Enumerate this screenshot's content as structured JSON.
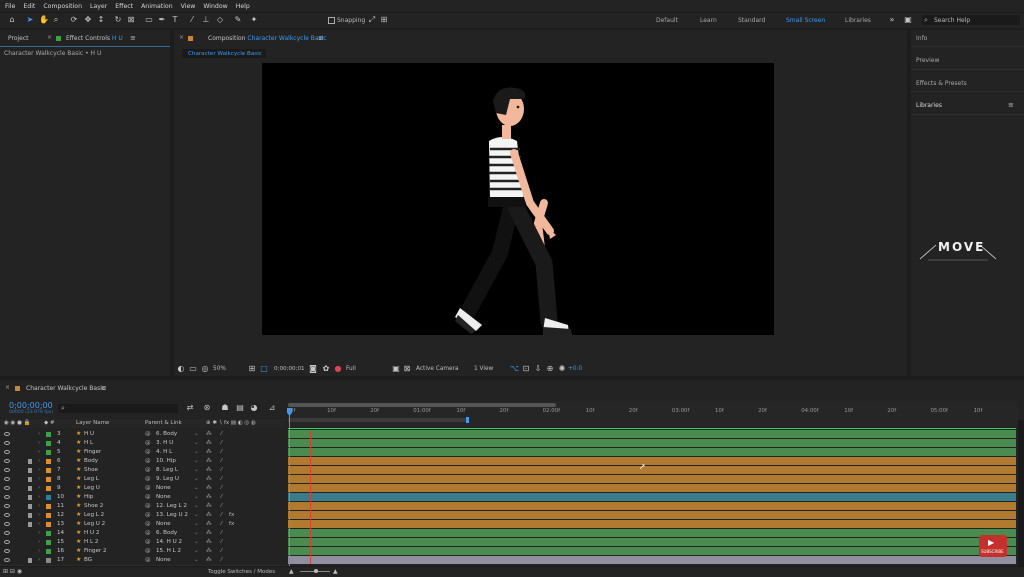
{
  "menu": [
    "File",
    "Edit",
    "Composition",
    "Layer",
    "Effect",
    "Animation",
    "View",
    "Window",
    "Help"
  ],
  "toolbar": {
    "snapping": "Snapping",
    "workspaces": [
      "Default",
      "Learn",
      "Standard",
      "Small Screen",
      "Libraries"
    ],
    "active_workspace": "Small Screen",
    "search_placeholder": "Search Help"
  },
  "left_panel": {
    "tab_project": "Project",
    "tab_effect_controls": "Effect Controls",
    "effect_controls_layer": "H U",
    "subtitle": "Character Walkcycle Basic • H U"
  },
  "composition_panel": {
    "tab_prefix": "Composition",
    "comp_name": "Character Walkcycle Basic",
    "sub_tab": "Character Walkcycle Basic"
  },
  "viewer_bar": {
    "zoom": "50%",
    "timecode": "0;00;00;01",
    "resolution": "Full",
    "camera": "Active Camera",
    "view": "1 View",
    "exposure": "+0.0"
  },
  "right_panel": [
    "Info",
    "Preview",
    "Effects & Presets",
    "Libraries"
  ],
  "watermark": "MOVE",
  "timeline": {
    "tab": "Character Walkcycle Basic",
    "current_time": "0;00;00;00",
    "frame_info": "00000 (23.976 fps)",
    "col_layer_name": "Layer Name",
    "col_parent": "Parent & Link",
    "ruler": [
      "0f",
      "10f",
      "20f",
      "01:00f",
      "10f",
      "20f",
      "02:00f",
      "10f",
      "20f",
      "03:00f",
      "10f",
      "20f",
      "04:00f",
      "10f",
      "20f",
      "05:00f",
      "10f"
    ],
    "toggle_label": "Toggle Switches / Modes",
    "layers": [
      {
        "num": "3",
        "name": "H U",
        "parent": "6. Body",
        "color": "#3fa04a",
        "bar": "#4a8c50",
        "locked": false,
        "fx": false
      },
      {
        "num": "4",
        "name": "H L",
        "parent": "3. H U",
        "color": "#3fa04a",
        "bar": "#4a8c50",
        "locked": false,
        "fx": false
      },
      {
        "num": "5",
        "name": "Finger",
        "parent": "4. H L",
        "color": "#3fa04a",
        "bar": "#4a8c50",
        "locked": false,
        "fx": false
      },
      {
        "num": "6",
        "name": "Body",
        "parent": "10. Hip",
        "color": "#d98f2b",
        "bar": "#b07a30",
        "locked": true,
        "fx": false
      },
      {
        "num": "7",
        "name": "Shoe",
        "parent": "8. Leg L",
        "color": "#d98f2b",
        "bar": "#b07a30",
        "locked": true,
        "fx": false
      },
      {
        "num": "8",
        "name": "Leg L",
        "parent": "9. Leg U",
        "color": "#d98f2b",
        "bar": "#b07a30",
        "locked": true,
        "fx": false
      },
      {
        "num": "9",
        "name": "Leg U",
        "parent": "None",
        "color": "#d98f2b",
        "bar": "#b07a30",
        "locked": true,
        "fx": false
      },
      {
        "num": "10",
        "name": "Hip",
        "parent": "None",
        "color": "#2c7fa0",
        "bar": "#3a7c8c",
        "locked": true,
        "fx": false
      },
      {
        "num": "11",
        "name": "Shoe 2",
        "parent": "12. Leg L 2",
        "color": "#d98f2b",
        "bar": "#b07a30",
        "locked": true,
        "fx": false
      },
      {
        "num": "12",
        "name": "Leg L 2",
        "parent": "13. Leg U 2",
        "color": "#d98f2b",
        "bar": "#b07a30",
        "locked": true,
        "fx": true
      },
      {
        "num": "13",
        "name": "Leg U 2",
        "parent": "None",
        "color": "#d98f2b",
        "bar": "#b07a30",
        "locked": true,
        "fx": true
      },
      {
        "num": "14",
        "name": "H U 2",
        "parent": "6. Body",
        "color": "#3fa04a",
        "bar": "#4a8c50",
        "locked": false,
        "fx": false
      },
      {
        "num": "15",
        "name": "H L 2",
        "parent": "14. H U 2",
        "color": "#3fa04a",
        "bar": "#4a8c50",
        "locked": false,
        "fx": false
      },
      {
        "num": "16",
        "name": "Finger 2",
        "parent": "15. H L 2",
        "color": "#3fa04a",
        "bar": "#4a8c50",
        "locked": false,
        "fx": false
      },
      {
        "num": "17",
        "name": "BG",
        "parent": "None",
        "color": "#8a8a8a",
        "bar": "#8f8fa0",
        "locked": true,
        "fx": false
      }
    ]
  },
  "youtube_badge": "SUBSCRIBE"
}
